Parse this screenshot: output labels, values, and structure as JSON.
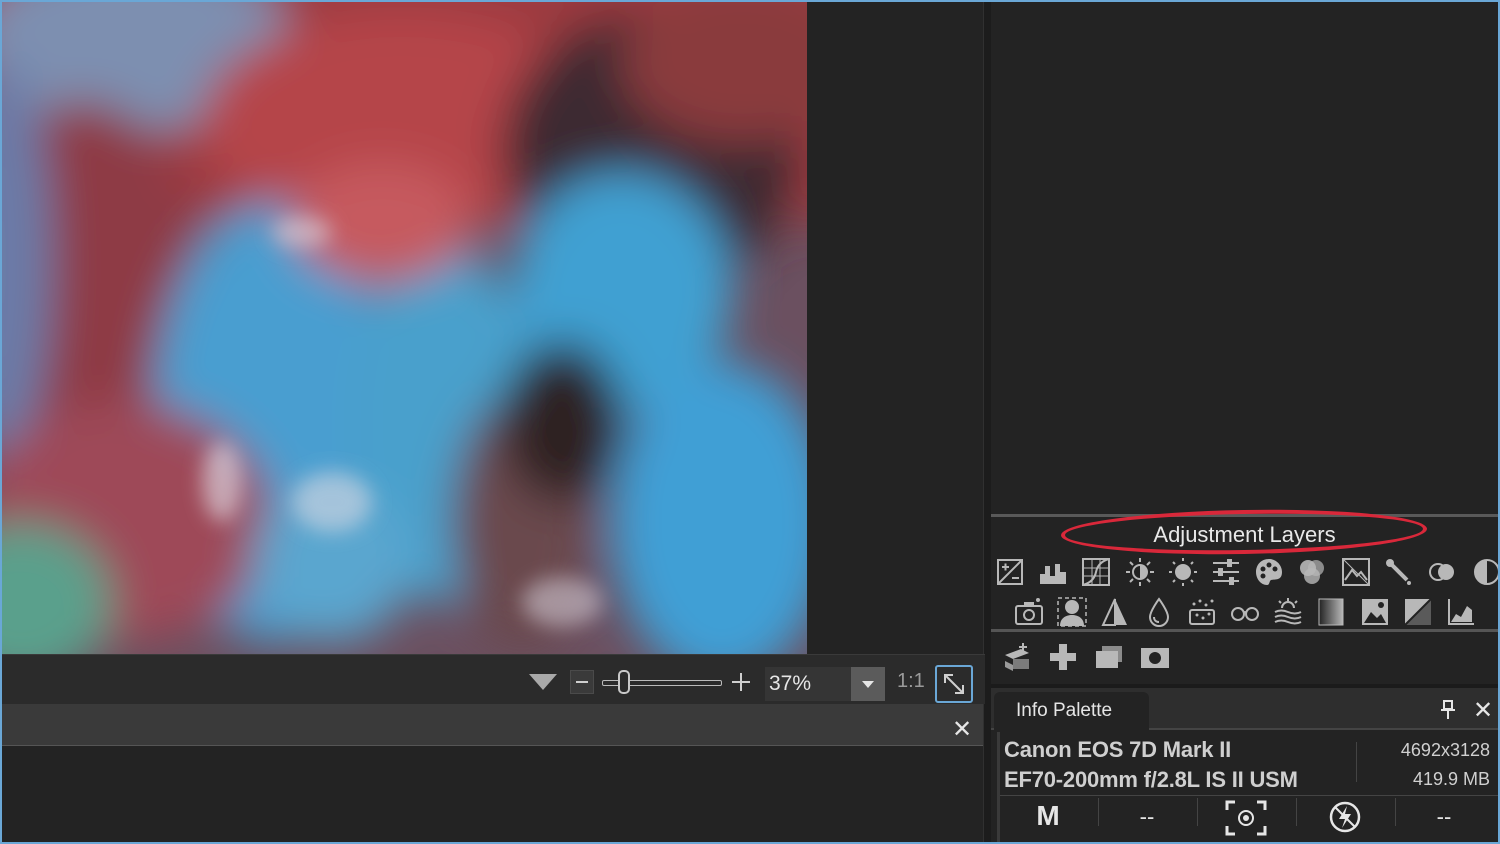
{
  "colors": {
    "accent": "#6aa7d6",
    "highlight_ring": "#d9283a",
    "panel_bg": "#232323"
  },
  "zoom": {
    "value": "37%",
    "one_to_one": "1:1",
    "level_fraction": 0.17
  },
  "adjustment_layers": {
    "title": "Adjustment Layers",
    "row1_icons": [
      "exposure-icon",
      "histogram-icon",
      "curves-icon",
      "brightness-icon",
      "sun-icon",
      "sliders-icon",
      "palette-icon",
      "color-mix-icon",
      "landscape-icon",
      "eyedropper-icon",
      "toggle-icon",
      "contrast-icon"
    ],
    "row2_icons": [
      "camera-icon",
      "portrait-icon",
      "sharpen-icon",
      "droplet-icon",
      "noise-icon",
      "glasses-icon",
      "haze-icon",
      "gradient-icon",
      "photo-icon",
      "split-tone-icon",
      "chart-icon"
    ],
    "actions": [
      "new-layer-icon",
      "add-icon",
      "duplicate-icon",
      "mask-icon"
    ]
  },
  "info_palette": {
    "tab_label": "Info Palette",
    "camera": "Canon EOS 7D Mark II",
    "lens": "EF70-200mm f/2.8L IS II USM",
    "dimensions": "4692x3128",
    "file_size": "419.9 MB",
    "mode": "M",
    "metering_1": "--",
    "metering_2": "--"
  },
  "bottom_close": "✕",
  "panel_close": "✕"
}
